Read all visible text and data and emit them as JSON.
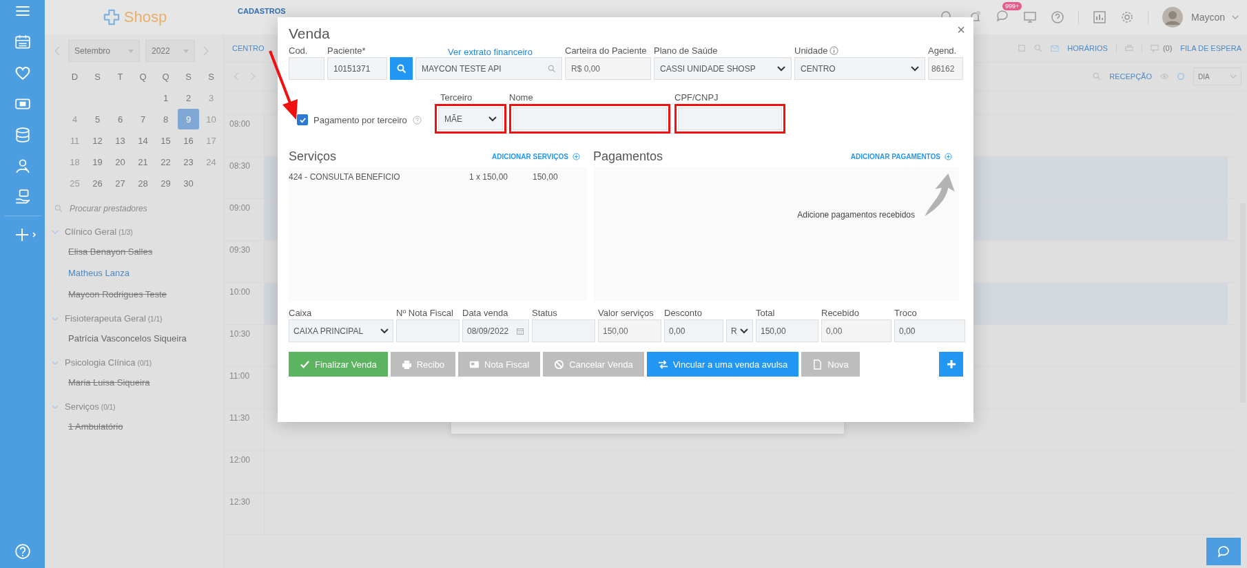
{
  "header": {
    "logo": "Shosp",
    "nav": [
      {
        "label": "CADASTROS",
        "selected": true
      }
    ],
    "notification_count": "999+",
    "user": "Maycon"
  },
  "calendar": {
    "month": "Setembro",
    "year": "2022",
    "weekdays": [
      "D",
      "S",
      "T",
      "Q",
      "Q",
      "S",
      "S"
    ],
    "weeks": [
      [
        {
          "day": "1",
          "muted": false,
          "selected": false
        },
        {
          "day": "2",
          "muted": false,
          "selected": false
        },
        {
          "day": "3",
          "muted": true,
          "selected": false
        }
      ],
      [
        {
          "day": "4",
          "muted": true,
          "selected": false
        },
        {
          "day": "5",
          "muted": false,
          "selected": false
        },
        {
          "day": "6",
          "muted": false,
          "selected": false
        },
        {
          "day": "7",
          "muted": false,
          "selected": false
        },
        {
          "day": "8",
          "muted": false,
          "selected": false
        },
        {
          "day": "9",
          "muted": false,
          "selected": true
        },
        {
          "day": "10",
          "muted": true,
          "selected": false
        }
      ],
      [
        {
          "day": "11",
          "muted": true,
          "selected": false
        },
        {
          "day": "12",
          "muted": false,
          "selected": false
        },
        {
          "day": "13",
          "muted": false,
          "selected": false
        },
        {
          "day": "14",
          "muted": false,
          "selected": false
        },
        {
          "day": "15",
          "muted": false,
          "selected": false
        },
        {
          "day": "16",
          "muted": false,
          "selected": false
        },
        {
          "day": "17",
          "muted": true,
          "selected": false
        }
      ],
      [
        {
          "day": "18",
          "muted": true,
          "selected": false
        },
        {
          "day": "19",
          "muted": false,
          "selected": false
        },
        {
          "day": "20",
          "muted": false,
          "selected": false
        },
        {
          "day": "21",
          "muted": false,
          "selected": false
        },
        {
          "day": "22",
          "muted": false,
          "selected": false
        },
        {
          "day": "23",
          "muted": false,
          "selected": false
        },
        {
          "day": "24",
          "muted": true,
          "selected": false
        }
      ],
      [
        {
          "day": "25",
          "muted": true,
          "selected": false
        },
        {
          "day": "26",
          "muted": false,
          "selected": false
        },
        {
          "day": "27",
          "muted": false,
          "selected": false
        },
        {
          "day": "28",
          "muted": false,
          "selected": false
        },
        {
          "day": "29",
          "muted": false,
          "selected": false
        },
        {
          "day": "30",
          "muted": false,
          "selected": false
        }
      ]
    ]
  },
  "providers": {
    "placeholder": "Procurar prestadores",
    "groups": [
      {
        "name": "Clínico Geral",
        "count": "(1/3)",
        "expanded": true,
        "children": [
          {
            "name": "Elisa Benayon Salles",
            "inactive": true,
            "selected": false
          },
          {
            "name": "Matheus Lanza",
            "inactive": false,
            "selected": true
          },
          {
            "name": "Maycon Rodrigues Teste",
            "inactive": true,
            "selected": false
          }
        ]
      },
      {
        "name": "Fisioterapeuta Geral",
        "count": "(1/1)",
        "expanded": true,
        "children": [
          {
            "name": "Patrícia Vasconcelos Siqueira",
            "inactive": false,
            "selected": false
          }
        ]
      },
      {
        "name": "Psicologia Clínica",
        "count": "(0/1)",
        "expanded": true,
        "children": [
          {
            "name": "Maria Luisa Siqueira",
            "inactive": true,
            "selected": false
          }
        ]
      },
      {
        "name": "Serviços",
        "count": "(0/1)",
        "expanded": true,
        "children": [
          {
            "name": "1 Ambulatório",
            "inactive": true,
            "selected": false
          }
        ]
      }
    ]
  },
  "toolbar": {
    "unit": "CENTRO",
    "links": [
      "HORÁRIOS",
      "(0)",
      "FILA DE ESPERA"
    ],
    "view_label": "RECEPÇÃO",
    "view": "DIA"
  },
  "schedule": {
    "times": [
      {
        "time": "08:00",
        "booked": false
      },
      {
        "time": "08:30",
        "booked": true
      },
      {
        "time": "09:00",
        "booked": true
      },
      {
        "time": "09:30",
        "booked": false
      },
      {
        "time": "10:00",
        "booked": true
      },
      {
        "time": "10:30",
        "booked": false
      },
      {
        "time": "11:00",
        "booked": false
      },
      {
        "time": "11:30",
        "booked": false
      },
      {
        "time": "12:00",
        "booked": false
      },
      {
        "time": "12:30",
        "booked": false
      }
    ]
  },
  "modal": {
    "title": "Venda",
    "close": "×",
    "patient": {
      "code_label": "Cod.",
      "patient_label": "Paciente*",
      "patient_id": "10151371",
      "statement_link": "Ver extrato financeiro",
      "patient_name": "MAYCON TESTE API",
      "wallet_label": "Carteira do Paciente",
      "wallet": "R$ 0,00",
      "plan_label": "Plano de Saúde",
      "plan": "CASSI UNIDADE SHOSP",
      "unit_label": "Unidade",
      "unit": "CENTRO",
      "schedule_label": "Agend.",
      "schedule": "86162"
    },
    "third_party": {
      "label": "Pagamento por terceiro",
      "checked": true,
      "annotation_arrow": true,
      "fields": [
        {
          "label": "Terceiro",
          "value": "MÃE",
          "kind": "select",
          "highlighted": true
        },
        {
          "label": "Nome",
          "kind": "text",
          "highlighted": true
        },
        {
          "label": "CPF/CNPJ",
          "kind": "text",
          "highlighted": true
        }
      ]
    },
    "services": {
      "title": "Serviços",
      "add": "ADICIONAR SERVIÇOS",
      "items": [
        {
          "name": "424 - CONSULTA BENEFICIO",
          "quantity": "1 x 150,00",
          "total": "150,00"
        }
      ]
    },
    "payments": {
      "title": "Pagamentos",
      "add": "ADICIONAR PAGAMENTOS",
      "hint": "Adicione pagamentos recebidos"
    },
    "summary": [
      {
        "label": "Caixa",
        "value": "CAIXA PRINCIPAL",
        "kind": "select"
      },
      {
        "label": "Nº Nota Fiscal",
        "kind": "text"
      },
      {
        "label": "Data venda",
        "value": "08/09/2022",
        "kind": "date"
      },
      {
        "label": "Status",
        "kind": "text"
      },
      {
        "label": "Valor serviços",
        "value": "150,00",
        "kind": "readonly"
      },
      {
        "label": "Desconto",
        "value": "0,00",
        "kind": "text"
      },
      {
        "value": "R",
        "kind": "select"
      },
      {
        "label": "Total",
        "value": "150,00",
        "kind": "text"
      },
      {
        "label": "Recebido",
        "value": "0,00",
        "kind": "readonly"
      },
      {
        "label": "Troco",
        "value": "0,00",
        "kind": "text"
      }
    ],
    "buttons": [
      {
        "label": "Finalizar Venda",
        "kind": "success"
      },
      {
        "label": "Recibo",
        "kind": "muted"
      },
      {
        "label": "Nota Fiscal",
        "kind": "muted"
      },
      {
        "label": "Cancelar Venda",
        "kind": "muted"
      },
      {
        "label": "Vincular a uma venda avulsa",
        "kind": "primary"
      },
      {
        "label": "Nova",
        "kind": "muted"
      }
    ]
  }
}
